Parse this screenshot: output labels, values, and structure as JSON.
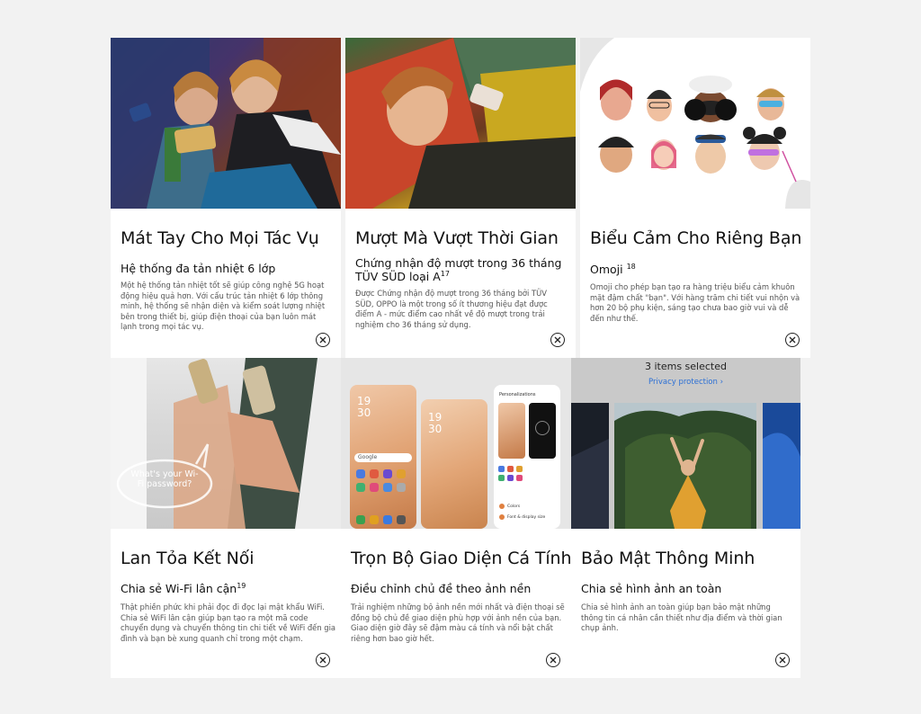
{
  "cards": [
    {
      "title": "Mát Tay Cho Mọi Tác Vụ",
      "subtitle": "Hệ thống đa tản nhiệt 6 lớp",
      "desc": "Một hệ thống tản nhiệt tốt sẽ giúp công nghệ 5G hoạt động hiệu quả hơn. Với cấu trúc tản nhiệt 6 lớp thông minh, hệ thống sẽ nhận diện và kiểm soát lượng nhiệt bên trong thiết bị, giúp điện thoại của bạn luôn mát lạnh trong mọi tác vụ."
    },
    {
      "title": "Mượt Mà Vượt Thời Gian",
      "subtitle": "Chứng nhận độ mượt trong 36 tháng TÜV SÜD loại A",
      "subtitle_sup": "17",
      "desc": "Được Chứng nhận độ mượt trong 36 tháng bởi TÜV SÜD, OPPO là một trong số ít thương hiệu đạt được điểm A - mức điểm cao nhất về độ mượt trong trải nghiệm cho 36 tháng sử dụng."
    },
    {
      "title": "Biểu Cảm Cho Riêng Bạn",
      "subtitle": "Omoji",
      "subtitle_sup": "18",
      "desc": "Omoji cho phép bạn tạo ra hàng triệu biểu cảm khuôn mặt đậm chất \"bạn\". Với hàng trăm chi tiết vui nhộn và hơn 20 bộ phụ kiện, sáng tạo chưa bao giờ vui và dễ đến như thế."
    },
    {
      "title": "Lan Tỏa Kết Nối",
      "subtitle": "Chia sẻ Wi-Fi lân cận",
      "subtitle_sup": "19",
      "desc": "Thật phiền phức khi phải đọc đi đọc lại mật khẩu WiFi. Chia sẻ WiFi lân cận giúp bạn tạo ra một mã code chuyển dụng và chuyển thông tin chi tiết về WiFi đến gia đình và bạn bè xung quanh chỉ trong một chạm.",
      "bubble": "What's your Wi-Fi password?"
    },
    {
      "title": "Trọn Bộ Giao Diện Cá Tính",
      "subtitle": "Điều chỉnh chủ đề theo ảnh nền",
      "desc": "Trải nghiệm những bộ ảnh nền mới nhất và điện thoại sẽ đồng bộ chủ đề giao diện phù hợp với ảnh nền của bạn. Giao diện giờ đây sẽ đậm màu cá tính và nổi bật chất riêng hơn bao giờ hết.",
      "clock_h": "19",
      "clock_m": "30",
      "search_label": "Google",
      "settings_title": "Personalizations",
      "menu_items": [
        "Colors",
        "Font & display size"
      ]
    },
    {
      "title": "Bảo Mật Thông Minh",
      "subtitle": "Chia sẻ hình ảnh an toàn",
      "desc": "Chia sẻ hình ảnh an toàn giúp bạn bảo mật những thông tin cá nhân cần thiết như địa điểm và thời gian chụp ảnh.",
      "selected_text": "3 items selected",
      "privacy_link": "Privacy protection ›"
    }
  ],
  "colors": {
    "background": "#f2f2f2",
    "card": "#ffffff",
    "link": "#2a6fd6"
  },
  "icons": {
    "close": "close-circle-icon"
  }
}
